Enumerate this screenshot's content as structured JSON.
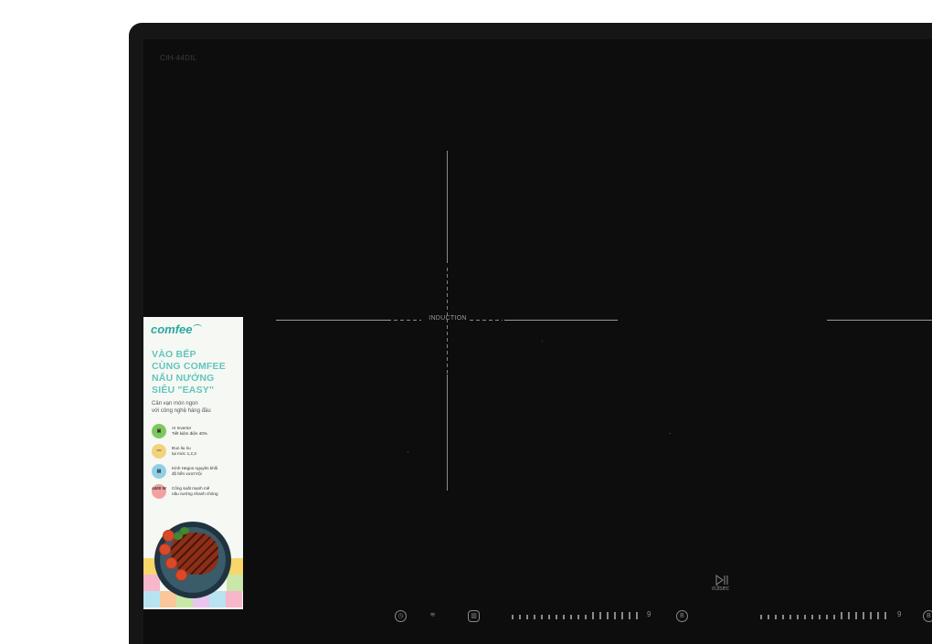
{
  "product": {
    "model_code": "CIH-44DIL",
    "zone_label": "INDUCTION"
  },
  "sticker": {
    "brand": "comfee",
    "headline": [
      "VÀO BẾP",
      "CÙNG COMFEE",
      "NẤU NƯỚNG",
      "SIÊU \"EASY\""
    ],
    "subtitle": [
      "Cân vạn món ngon",
      "với công nghệ hàng đầu"
    ],
    "features": [
      {
        "icon": "chip-icon",
        "color": "#7ec860",
        "badge": "",
        "lines": [
          "AI Inverter",
          "Tiết kiệm điện 40%"
        ]
      },
      {
        "icon": "simmer-icon",
        "color": "#f2d27a",
        "badge": "",
        "lines": [
          "Đun liu riu",
          "tại mức 1,2,3"
        ]
      },
      {
        "icon": "glass-panel-icon",
        "color": "#8fd0e8",
        "badge": "",
        "lines": [
          "Kính Hegon nguyên khối",
          "độ bền vượt trội"
        ]
      },
      {
        "icon": "power-icon",
        "color": "#f3a0a0",
        "badge": "4400 W",
        "lines": [
          "Công suất mạnh mẽ",
          "nấu nướng nhanh chóng"
        ]
      }
    ],
    "tile_colors": [
      "#f7d76a",
      "#b8e3f0",
      "#f5b7c9",
      "#c9e7a8",
      "#e9c5f0",
      "#f9c79a"
    ]
  },
  "controls": {
    "pause_label": "3sec",
    "slider_max_label": "9",
    "bottom_icons": [
      "timer-icon",
      "heat-wave-icon",
      "zone-select-icon",
      "boost-icon",
      "boost-icon"
    ]
  }
}
